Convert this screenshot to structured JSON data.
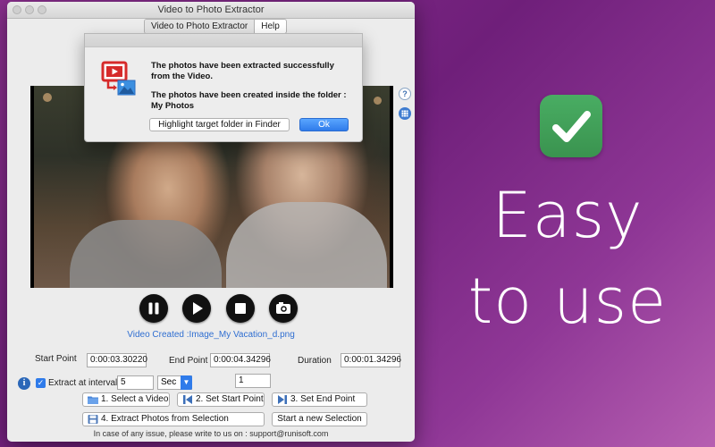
{
  "window": {
    "title": "Video to Photo Extractor",
    "tabs": [
      "Video to Photo Extractor",
      "Help"
    ]
  },
  "alert": {
    "message_line1": "The photos have been extracted successfully from the Video.",
    "message_line2": "The photos have been created inside the folder : My Photos",
    "highlight_button": "Highlight target folder in Finder",
    "ok_button": "Ok"
  },
  "player": {
    "video_created": "Video Created :Image_My Vacation_d.png"
  },
  "timing": {
    "start_label": "Start Point",
    "start_value": "0:00:03.30220",
    "end_label": "End Point",
    "end_value": "0:00:04.34296",
    "duration_label": "Duration",
    "duration_value": "0:00:01.34296"
  },
  "interval": {
    "checkbox_label": "Extract at interval",
    "checked": true,
    "value": "5",
    "unit": "Sec",
    "count": "1"
  },
  "buttons": {
    "select_video": "1. Select a Video",
    "set_start": "2. Set Start Point",
    "set_end": "3. Set End Point",
    "extract": "4. Extract Photos from Selection",
    "new_selection": "Start a new Selection"
  },
  "footer": "In case of any issue, please write to us on : support@runisoft.com",
  "side_help": "?",
  "promo": {
    "line1": "Easy",
    "line2": "to use"
  },
  "colors": {
    "accent": "#2f7bea",
    "promo_check": "#3fa25a",
    "link": "#2f6ed1"
  }
}
